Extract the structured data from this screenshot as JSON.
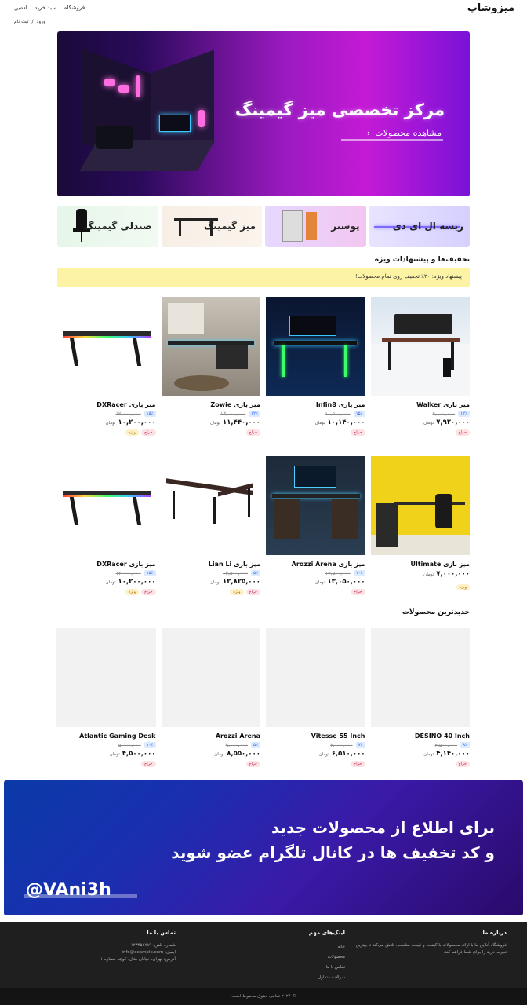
{
  "header": {
    "brand": "میزوشاپ",
    "nav": [
      "فروشگاه",
      "سبد خرید",
      "ادمین"
    ],
    "auth": {
      "login": "ورود",
      "separator": "/",
      "register": "ثبت نام"
    }
  },
  "hero": {
    "title": "مرکز تخصصی میز گیمینگ",
    "cta": "مشاهده محصولات"
  },
  "categories": [
    "ریسه ال ای دی",
    "پوستر",
    "میز گیمینگ",
    "صندلی گیمینگ"
  ],
  "deals": {
    "title": "تخفیف‌ها و پیشنهادات ویژه",
    "promo": "پیشنهاد ویژه: ۲۰٪ تخفیف روی تمام محصولات!"
  },
  "currency": "تومان",
  "deal_row_1": [
    {
      "name": "میز بازی Walker",
      "old": "۹,۰۰۰,۰۰۰",
      "pct": "۱۲٪",
      "price": "۷,۹۲۰,۰۰۰",
      "badges": [
        "حراج"
      ]
    },
    {
      "name": "میز بازی Infin8",
      "old": "۱۱,۵۰۰,۰۰۰",
      "pct": "۱۵٪",
      "price": "۱۰,۱۴۰,۰۰۰",
      "badges": [
        "حراج"
      ]
    },
    {
      "name": "میز بازی Zowie",
      "old": "۱۳,۰۰۰,۰۰۰",
      "pct": "۱۲٪",
      "price": "۱۱,۴۴۰,۰۰۰",
      "badges": [
        "حراج"
      ]
    },
    {
      "name": "میز بازی DXRacer",
      "old": "۱۲,۰۰۰,۰۰۰",
      "pct": "۱۵٪",
      "price": "۱۰,۲۰۰,۰۰۰",
      "badges": [
        "حراج",
        "ویژه"
      ]
    }
  ],
  "deal_row_2": [
    {
      "name": "میز بازی Ultimate",
      "old": "",
      "pct": "",
      "price": "۷,۰۰۰,۰۰۰",
      "badges": [
        "ویژه"
      ]
    },
    {
      "name": "میز بازی Arozzi Arena",
      "old": "۱۴,۵۰۰,۰۰۰",
      "pct": "۱۰٪",
      "price": "۱۳,۰۵۰,۰۰۰",
      "badges": [
        "حراج"
      ]
    },
    {
      "name": "میز بازی Lian Li",
      "old": "۱۳,۵۰۰,۰۰۰",
      "pct": "۵٪",
      "price": "۱۲,۸۲۵,۰۰۰",
      "badges": [
        "حراج",
        "ویژه"
      ]
    },
    {
      "name": "میز بازی DXRacer",
      "old": "۱۲,۰۰۰,۰۰۰",
      "pct": "۱۵٪",
      "price": "۱۰,۲۰۰,۰۰۰",
      "badges": [
        "حراج",
        "ویژه"
      ]
    }
  ],
  "latest": {
    "title": "جدیدترین محصولات",
    "items": [
      {
        "name": "DESINO 40 Inch",
        "old": "۴,۵۰۰,۰۰۰",
        "pct": "۸٪",
        "price": "۴,۱۴۰,۰۰۰",
        "badges": [
          "حراج"
        ]
      },
      {
        "name": "Vitesse 55 Inch",
        "old": "۷,۰۰۰,۰۰۰",
        "pct": "۷٪",
        "price": "۶,۵۱۰,۰۰۰",
        "badges": [
          "حراج"
        ]
      },
      {
        "name": "Arozzi Arena",
        "old": "۹,۰۰۰,۰۰۰",
        "pct": "۵٪",
        "price": "۸,۵۵۰,۰۰۰",
        "badges": [
          "حراج"
        ]
      },
      {
        "name": "Atlantic Gaming Desk",
        "old": "۵,۰۰۰,۰۰۰",
        "pct": "۱۰٪",
        "price": "۴,۵۰۰,۰۰۰",
        "badges": [
          "حراج"
        ]
      }
    ]
  },
  "telegram": {
    "line1": "برای اطلاع از محصولات جدید",
    "line2": "و کد تخفیف ها در کانال تلگرام عضو شوید",
    "handle": "@VAni3h"
  },
  "footer": {
    "about_title": "درباره ما",
    "about_text": "فروشگاه آنلاین ما با ارائه محصولات با کیفیت و قیمت مناسب، تلاش می‌کند تا بهترین تجربه خرید را برای شما فراهم کند.",
    "links_title": "لینک‌های مهم",
    "links": [
      "خانه",
      "محصولات",
      "تماس با ما",
      "سوالات متداول"
    ],
    "contact_title": "تماس با ما",
    "contact": [
      "شماره تلفن: ۱۲۳۴۵۶۷۸۹",
      "ایمیل: info@example.com",
      "آدرس: تهران، خیابان مثال، کوچه شماره ۱"
    ],
    "copyright": "© ۲۰۲۴ تمامی حقوق محفوظ است."
  },
  "colors": {
    "accent": "#9a1ac0",
    "promo_bg": "#fdf3a4",
    "footer_bg": "#1f1f1f"
  }
}
